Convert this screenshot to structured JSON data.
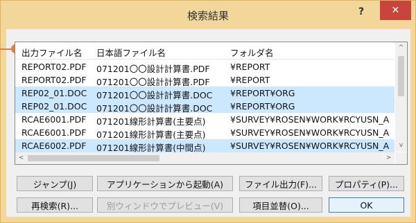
{
  "window": {
    "title": "検索結果",
    "help_label": "?",
    "close_label": "✕"
  },
  "list": {
    "columns": [
      "出力ファイル名",
      "日本語ファイル名",
      "フォルダ名"
    ],
    "rows": [
      {
        "file": "REPORT02.PDF",
        "jname": "071201〇〇設計計算書.PDF",
        "folder": "¥REPORT",
        "selected": false
      },
      {
        "file": "REPORT02.PDF",
        "jname": "071201〇〇設計計算書.PDF",
        "folder": "¥REPORT",
        "selected": false
      },
      {
        "file": "REP02_01.DOC",
        "jname": "071201〇〇設計計算書.DOC",
        "folder": "¥REPORT¥ORG",
        "selected": true
      },
      {
        "file": "REP02_01.DOC",
        "jname": "071201〇〇設計計算書.DOC",
        "folder": "¥REPORT¥ORG",
        "selected": true
      },
      {
        "file": "RCAE6001.PDF",
        "jname": "071201線形計算書(主要点)",
        "folder": "¥SURVEY¥ROSEN¥WORK¥RCYUSN_A",
        "selected": false
      },
      {
        "file": "RCAE6001.PDF",
        "jname": "071201線形計算書(主要点)",
        "folder": "¥SURVEY¥ROSEN¥WORK¥RCYUSN_A",
        "selected": false
      },
      {
        "file": "RCAE6002.PDF",
        "jname": "071201線形計算書(中間点)",
        "folder": "¥SURVEY¥ROSEN¥WORK¥RCYUSN_A",
        "selected": true
      }
    ],
    "scroll_up": "^",
    "scroll_down": "v",
    "scroll_left": "<",
    "scroll_right": ">"
  },
  "buttons": {
    "jump": "ジャンプ(J)",
    "launch_app": "アプリケーションから起動(A)",
    "file_output": "ファイル出力(F)...",
    "properties": "プロパティ(P)...",
    "research": "再検索(R)...",
    "preview": "別ウィンドウでプレビュー(V)",
    "sort": "項目並替(O)...",
    "ok": "OK"
  },
  "colors": {
    "frame": "#f3d79a",
    "close_button": "#c7453a",
    "selection": "#cce8ff",
    "marker": "#e4803c"
  }
}
